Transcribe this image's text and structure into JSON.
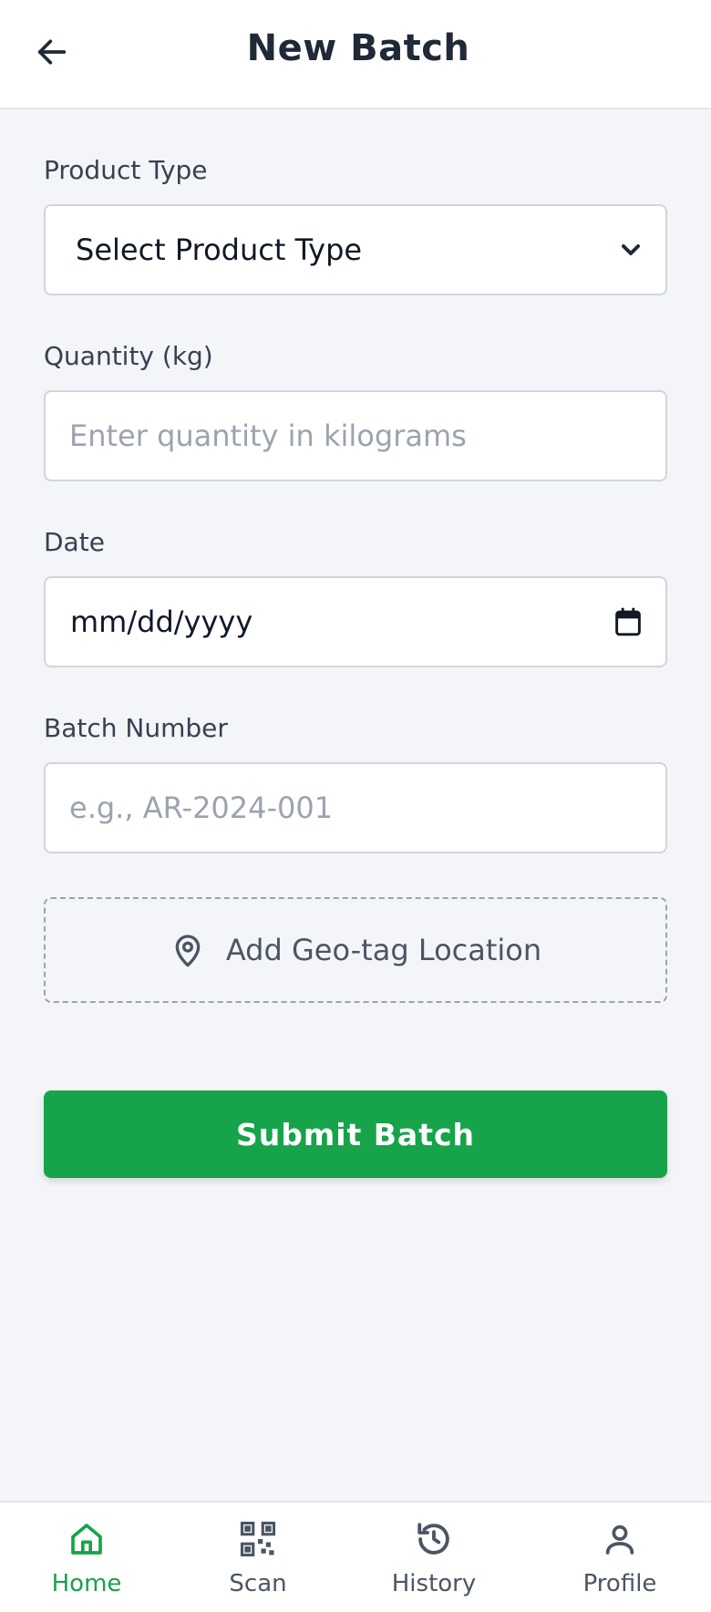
{
  "header": {
    "title": "New Batch"
  },
  "form": {
    "product_type": {
      "label": "Product Type",
      "selected": "Select Product Type"
    },
    "quantity": {
      "label": "Quantity (kg)",
      "placeholder": "Enter quantity in kilograms"
    },
    "date": {
      "label": "Date",
      "value": "mm/dd/yyyy"
    },
    "batch_number": {
      "label": "Batch Number",
      "placeholder": "e.g., AR-2024-001"
    },
    "geo_button_label": "Add Geo-tag Location",
    "submit_label": "Submit Batch"
  },
  "nav": {
    "items": [
      {
        "label": "Home",
        "icon": "home-icon",
        "active": true
      },
      {
        "label": "Scan",
        "icon": "qr-scan-icon",
        "active": false
      },
      {
        "label": "History",
        "icon": "history-icon",
        "active": false
      },
      {
        "label": "Profile",
        "icon": "user-icon",
        "active": false
      }
    ]
  },
  "colors": {
    "accent": "#16a34a",
    "background": "#f3f5f8",
    "text": "#1f2937"
  }
}
